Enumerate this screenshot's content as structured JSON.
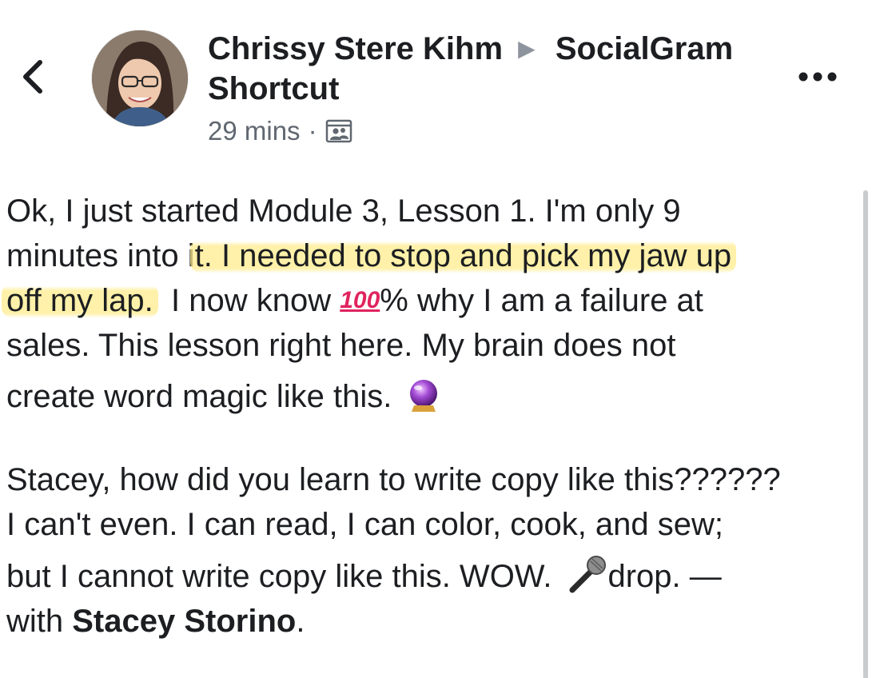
{
  "header": {
    "author": "Chrissy Stere Kihm",
    "separator_icon": "right-triangle-icon",
    "group": "SocialGram Shortcut",
    "timestamp": "29 mins",
    "meta_separator": "·",
    "audience_icon": "group-audience-icon",
    "back_icon": "chevron-left-icon",
    "more_icon": "more-dots-icon"
  },
  "post": {
    "p1": {
      "l1": "Ok, I just started Module 3, Lesson 1.  I'm only 9",
      "l2_plain": "minutes into i",
      "l2_highlight": "t.  I needed to stop and pick my jaw up",
      "l3_highlight": "off my lap.",
      "l3_a": "  I now know ",
      "l3_emoji": "100",
      "l3_b": "% why I am a failure at",
      "l4": "sales.  This lesson right here.  My brain does not",
      "l5": "create word magic like this."
    },
    "p2": {
      "l1": "Stacey, how did you learn to write copy like this??????",
      "l2": "I can't even.  I can read, I can color, cook, and sew;",
      "l3_a": "but I cannot write copy like this.  WOW.",
      "l3_b": "drop. —",
      "l4_a": "with ",
      "l4_tag": "Stacey Storino",
      "l4_b": "."
    }
  },
  "colors": {
    "highlight": "#ffec8c",
    "text": "#1c1e21",
    "meta": "#606770",
    "emoji_100": "#e0245e"
  }
}
